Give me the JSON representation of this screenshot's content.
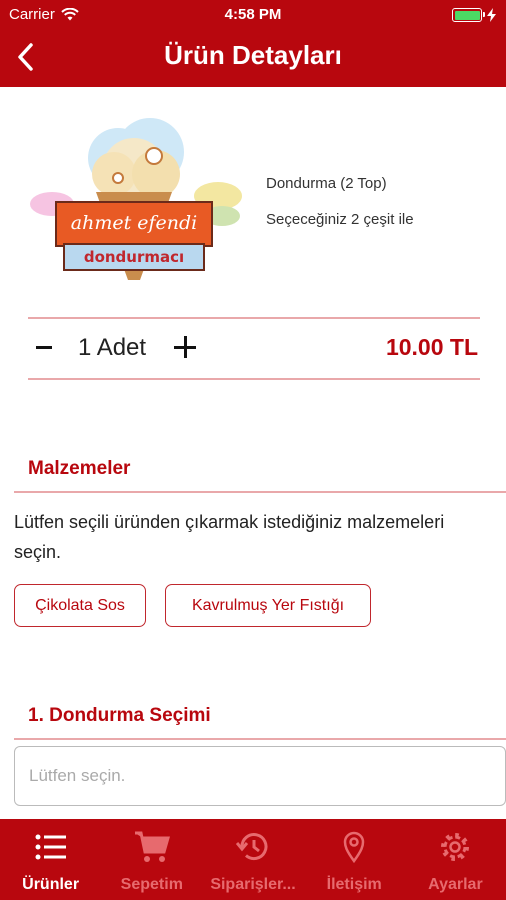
{
  "status_bar": {
    "carrier": "Carrier",
    "time": "4:58 PM"
  },
  "nav": {
    "title": "Ürün Detayları",
    "back_icon": "chevron-left-icon"
  },
  "product": {
    "logo_line1": "ahmet efendi",
    "logo_line2": "dondurmacı",
    "name": "Dondurma (2 Top)",
    "description": "Seçeceğiniz 2 çeşit ile"
  },
  "quantity": {
    "text": "1 Adet",
    "price": "10.00 TL"
  },
  "ingredients": {
    "title": "Malzemeler",
    "help_text": "Lütfen seçili üründen çıkarmak istediğiniz malzemeleri seçin.",
    "chips": [
      "Çikolata Sos",
      "Kavrulmuş Yer Fıstığı"
    ]
  },
  "selection": {
    "title": "1. Dondurma Seçimi",
    "placeholder": "Lütfen seçin."
  },
  "tabs": [
    {
      "label": "Ürünler",
      "icon": "list-icon",
      "active": true
    },
    {
      "label": "Sepetim",
      "icon": "cart-icon",
      "active": false
    },
    {
      "label": "Siparişler...",
      "icon": "history-icon",
      "active": false
    },
    {
      "label": "İletişim",
      "icon": "location-pin-icon",
      "active": false
    },
    {
      "label": "Ayarlar",
      "icon": "gear-icon",
      "active": false
    }
  ],
  "colors": {
    "brand": "#b8070e",
    "divider": "#e9a8aa",
    "tab_inactive": "#e76a6e"
  }
}
